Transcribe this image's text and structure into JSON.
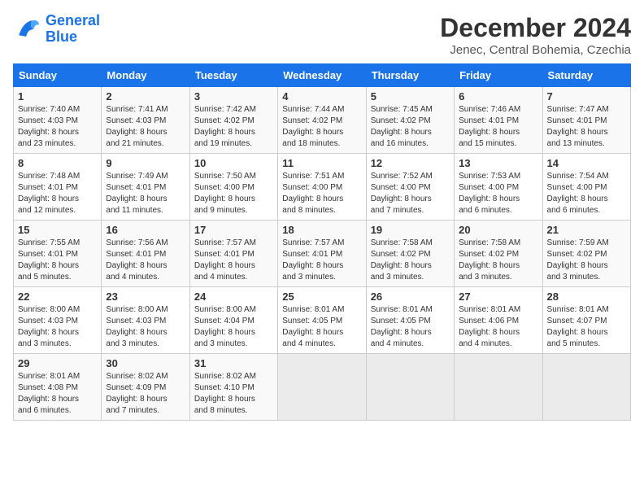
{
  "header": {
    "logo_line1": "General",
    "logo_line2": "Blue",
    "title": "December 2024",
    "subtitle": "Jenec, Central Bohemia, Czechia"
  },
  "days_of_week": [
    "Sunday",
    "Monday",
    "Tuesday",
    "Wednesday",
    "Thursday",
    "Friday",
    "Saturday"
  ],
  "weeks": [
    [
      {
        "day": "1",
        "info": "Sunrise: 7:40 AM\nSunset: 4:03 PM\nDaylight: 8 hours\nand 23 minutes."
      },
      {
        "day": "2",
        "info": "Sunrise: 7:41 AM\nSunset: 4:03 PM\nDaylight: 8 hours\nand 21 minutes."
      },
      {
        "day": "3",
        "info": "Sunrise: 7:42 AM\nSunset: 4:02 PM\nDaylight: 8 hours\nand 19 minutes."
      },
      {
        "day": "4",
        "info": "Sunrise: 7:44 AM\nSunset: 4:02 PM\nDaylight: 8 hours\nand 18 minutes."
      },
      {
        "day": "5",
        "info": "Sunrise: 7:45 AM\nSunset: 4:02 PM\nDaylight: 8 hours\nand 16 minutes."
      },
      {
        "day": "6",
        "info": "Sunrise: 7:46 AM\nSunset: 4:01 PM\nDaylight: 8 hours\nand 15 minutes."
      },
      {
        "day": "7",
        "info": "Sunrise: 7:47 AM\nSunset: 4:01 PM\nDaylight: 8 hours\nand 13 minutes."
      }
    ],
    [
      {
        "day": "8",
        "info": "Sunrise: 7:48 AM\nSunset: 4:01 PM\nDaylight: 8 hours\nand 12 minutes."
      },
      {
        "day": "9",
        "info": "Sunrise: 7:49 AM\nSunset: 4:01 PM\nDaylight: 8 hours\nand 11 minutes."
      },
      {
        "day": "10",
        "info": "Sunrise: 7:50 AM\nSunset: 4:00 PM\nDaylight: 8 hours\nand 9 minutes."
      },
      {
        "day": "11",
        "info": "Sunrise: 7:51 AM\nSunset: 4:00 PM\nDaylight: 8 hours\nand 8 minutes."
      },
      {
        "day": "12",
        "info": "Sunrise: 7:52 AM\nSunset: 4:00 PM\nDaylight: 8 hours\nand 7 minutes."
      },
      {
        "day": "13",
        "info": "Sunrise: 7:53 AM\nSunset: 4:00 PM\nDaylight: 8 hours\nand 6 minutes."
      },
      {
        "day": "14",
        "info": "Sunrise: 7:54 AM\nSunset: 4:00 PM\nDaylight: 8 hours\nand 6 minutes."
      }
    ],
    [
      {
        "day": "15",
        "info": "Sunrise: 7:55 AM\nSunset: 4:01 PM\nDaylight: 8 hours\nand 5 minutes."
      },
      {
        "day": "16",
        "info": "Sunrise: 7:56 AM\nSunset: 4:01 PM\nDaylight: 8 hours\nand 4 minutes."
      },
      {
        "day": "17",
        "info": "Sunrise: 7:57 AM\nSunset: 4:01 PM\nDaylight: 8 hours\nand 4 minutes."
      },
      {
        "day": "18",
        "info": "Sunrise: 7:57 AM\nSunset: 4:01 PM\nDaylight: 8 hours\nand 3 minutes."
      },
      {
        "day": "19",
        "info": "Sunrise: 7:58 AM\nSunset: 4:02 PM\nDaylight: 8 hours\nand 3 minutes."
      },
      {
        "day": "20",
        "info": "Sunrise: 7:58 AM\nSunset: 4:02 PM\nDaylight: 8 hours\nand 3 minutes."
      },
      {
        "day": "21",
        "info": "Sunrise: 7:59 AM\nSunset: 4:02 PM\nDaylight: 8 hours\nand 3 minutes."
      }
    ],
    [
      {
        "day": "22",
        "info": "Sunrise: 8:00 AM\nSunset: 4:03 PM\nDaylight: 8 hours\nand 3 minutes."
      },
      {
        "day": "23",
        "info": "Sunrise: 8:00 AM\nSunset: 4:03 PM\nDaylight: 8 hours\nand 3 minutes."
      },
      {
        "day": "24",
        "info": "Sunrise: 8:00 AM\nSunset: 4:04 PM\nDaylight: 8 hours\nand 3 minutes."
      },
      {
        "day": "25",
        "info": "Sunrise: 8:01 AM\nSunset: 4:05 PM\nDaylight: 8 hours\nand 4 minutes."
      },
      {
        "day": "26",
        "info": "Sunrise: 8:01 AM\nSunset: 4:05 PM\nDaylight: 8 hours\nand 4 minutes."
      },
      {
        "day": "27",
        "info": "Sunrise: 8:01 AM\nSunset: 4:06 PM\nDaylight: 8 hours\nand 4 minutes."
      },
      {
        "day": "28",
        "info": "Sunrise: 8:01 AM\nSunset: 4:07 PM\nDaylight: 8 hours\nand 5 minutes."
      }
    ],
    [
      {
        "day": "29",
        "info": "Sunrise: 8:01 AM\nSunset: 4:08 PM\nDaylight: 8 hours\nand 6 minutes."
      },
      {
        "day": "30",
        "info": "Sunrise: 8:02 AM\nSunset: 4:09 PM\nDaylight: 8 hours\nand 7 minutes."
      },
      {
        "day": "31",
        "info": "Sunrise: 8:02 AM\nSunset: 4:10 PM\nDaylight: 8 hours\nand 8 minutes."
      },
      {
        "day": "",
        "info": ""
      },
      {
        "day": "",
        "info": ""
      },
      {
        "day": "",
        "info": ""
      },
      {
        "day": "",
        "info": ""
      }
    ]
  ]
}
